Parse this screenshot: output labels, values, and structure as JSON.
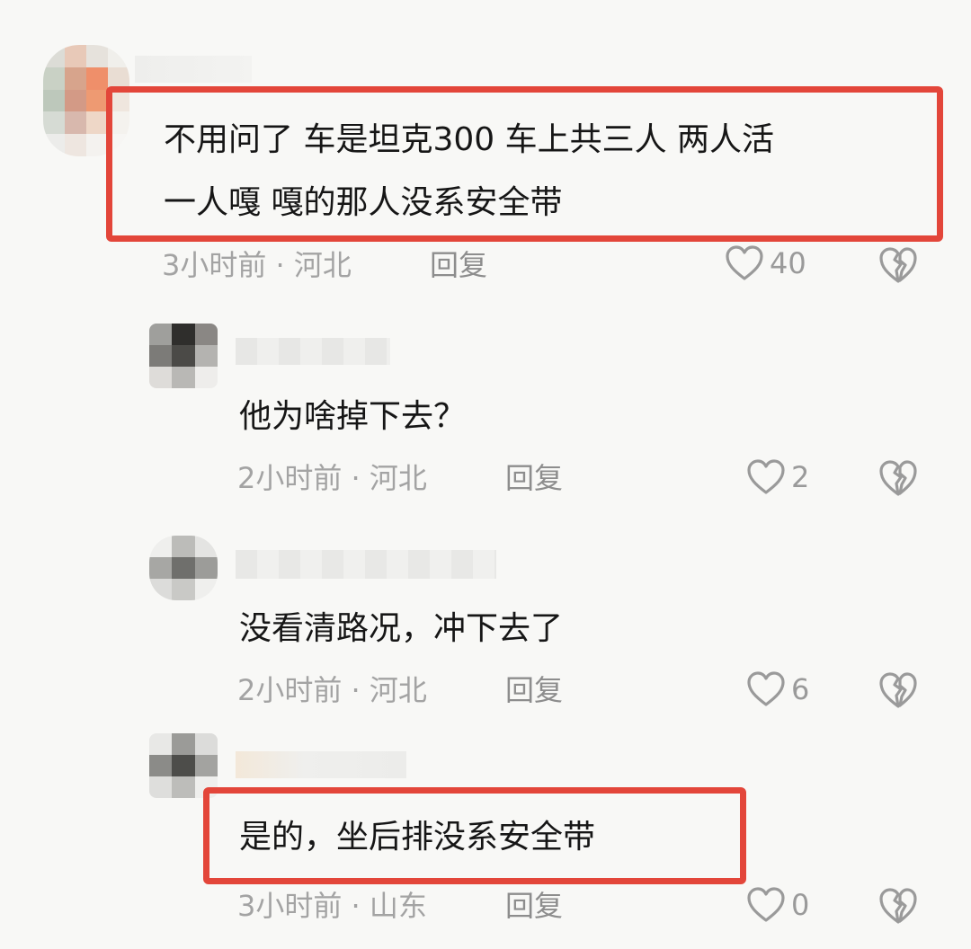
{
  "colors": {
    "background": "#f8f8f6",
    "highlight": "#e3463a",
    "text": "#161616",
    "meta": "#a3a3a3"
  },
  "comments": [
    {
      "text_lines": [
        "不用问了 车是坦克300 车上共三人 两人活",
        "一人嘎 嘎的那人没系安全带"
      ],
      "time_location": "3小时前 · 河北",
      "reply_label": "回复",
      "like_count": "40",
      "highlighted": true
    },
    {
      "text_lines": [
        "他为啥掉下去？"
      ],
      "time_location": "2小时前 · 河北",
      "reply_label": "回复",
      "like_count": "2",
      "highlighted": false
    },
    {
      "text_lines": [
        "没看清路况，冲下去了"
      ],
      "time_location": "2小时前 · 河北",
      "reply_label": "回复",
      "like_count": "6",
      "highlighted": false
    },
    {
      "text_lines": [
        "是的，坐后排没系安全带"
      ],
      "time_location": "3小时前 · 山东",
      "reply_label": "回复",
      "like_count": "0",
      "highlighted": true
    }
  ],
  "icons": {
    "like": "heart-outline-icon",
    "dislike": "broken-heart-icon"
  }
}
